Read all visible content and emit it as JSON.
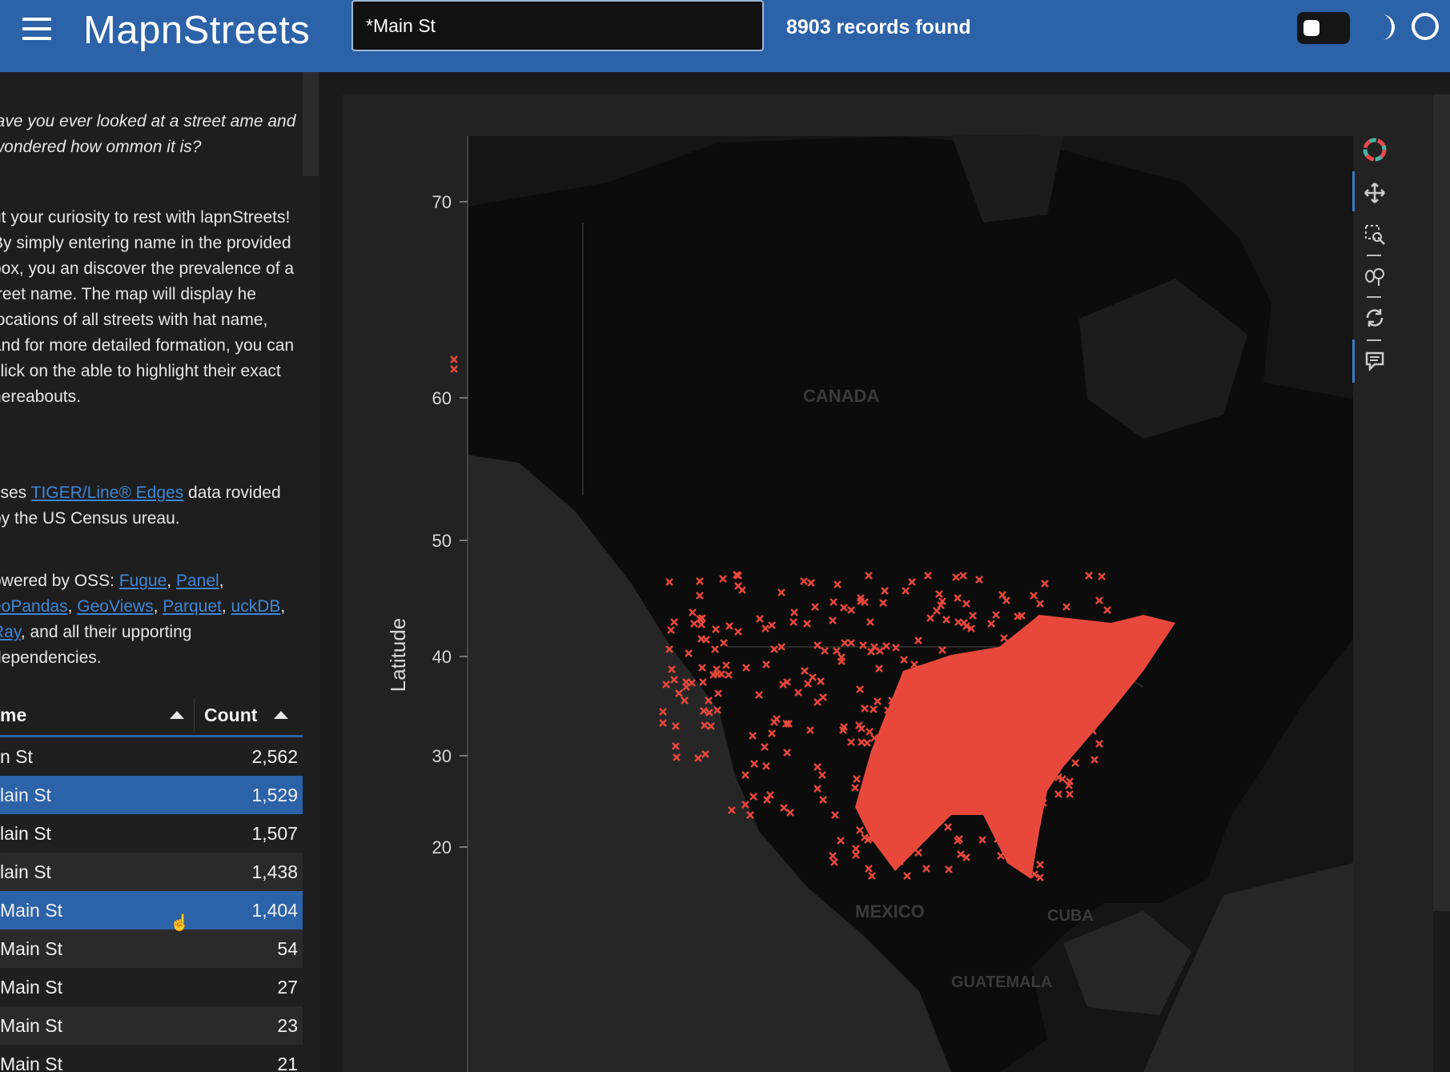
{
  "header": {
    "app_title": "MapnStreets",
    "search_value": "*Main St",
    "records_found": "8903 records found",
    "icons": [
      "menu-icon",
      "theme-toggle",
      "moon-icon",
      "circle-icon"
    ]
  },
  "sidebar": {
    "intro": "lave you ever looked at a street ame and wondered how ommon it is?",
    "description": "ut your curiosity to rest with lapnStreets! By simply entering name in the provided box, you an discover the prevalence of a treet name. The map will display he locations of all streets with hat name, and for more detailed formation, you can click on the able to highlight their exact hereabouts.",
    "source_prefix": "Jses ",
    "source_link": "TIGER/Line® Edges",
    "source_suffix": " data rovided by the US Census ureau.",
    "powered_prefix": "owered by OSS: ",
    "powered_links": [
      "Fugue",
      "Panel",
      "eoPandas",
      "GeoViews",
      "Parquet",
      "uckDB",
      "Ray"
    ],
    "powered_suffix": ", and all their upporting dependencies.",
    "table": {
      "headers": [
        "me",
        "Count"
      ],
      "rows": [
        {
          "name": "n St",
          "count": "2,562",
          "selected": false
        },
        {
          "name": "lain St",
          "count": "1,529",
          "selected": true
        },
        {
          "name": "lain St",
          "count": "1,507",
          "selected": false
        },
        {
          "name": "lain St",
          "count": "1,438",
          "selected": false
        },
        {
          "name": "Main St",
          "count": "1,404",
          "selected": true
        },
        {
          "name": " Main St",
          "count": "54",
          "selected": false
        },
        {
          "name": "Main St",
          "count": "27",
          "selected": false
        },
        {
          "name": "Main St",
          "count": "23",
          "selected": false
        },
        {
          "name": "Main St",
          "count": "21",
          "selected": false
        }
      ]
    }
  },
  "map": {
    "y_axis_label": "Latitude",
    "y_ticks": [
      "70",
      "60",
      "50",
      "40",
      "30",
      "20"
    ],
    "place_labels": [
      "CANADA",
      "MEXICO",
      "CUBA",
      "GUATEMALA"
    ],
    "marker_color": "#e8483b",
    "toolbar_icons": [
      "bokeh-logo-icon",
      "pan-icon",
      "box-zoom-icon",
      "wheel-zoom-icon",
      "reset-icon",
      "hover-icon"
    ]
  },
  "colors": {
    "header_bg": "#2c62a8",
    "accent": "#2c62a8",
    "link": "#3f86d6",
    "panel_bg": "#1e1e1f",
    "map_bg": "#151515"
  }
}
